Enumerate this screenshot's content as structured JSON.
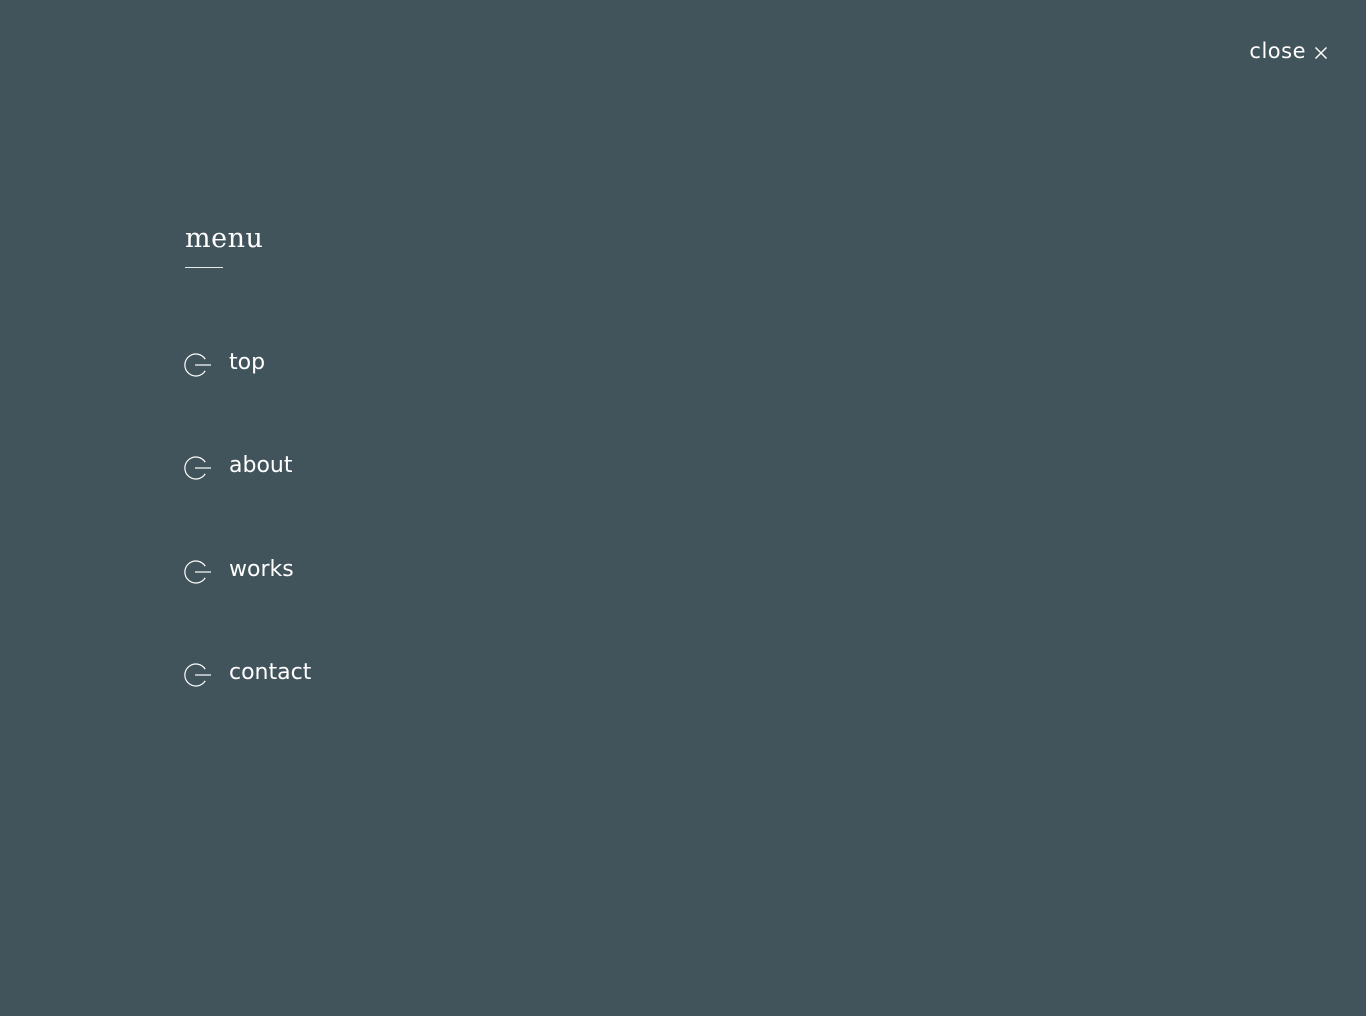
{
  "theme": {
    "background": "#41545c",
    "foreground": "#ffffff"
  },
  "close": {
    "label": "close",
    "icon": "close-icon"
  },
  "menu": {
    "heading": "menu",
    "items": [
      {
        "label": "top",
        "icon": "circle-arrow-icon"
      },
      {
        "label": "about",
        "icon": "circle-arrow-icon"
      },
      {
        "label": "works",
        "icon": "circle-arrow-icon"
      },
      {
        "label": "contact",
        "icon": "circle-arrow-icon"
      }
    ]
  }
}
